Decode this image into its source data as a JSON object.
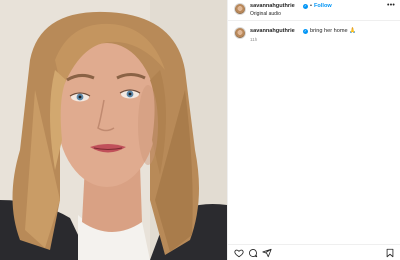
{
  "post": {
    "username": "savannahguthrie",
    "verified_glyph": "✓",
    "separator": "•",
    "follow_label": "Follow",
    "audio_label": "Original audio",
    "more_glyph": "•••"
  },
  "caption": {
    "username": "savannahguthrie",
    "verified_glyph": "✓",
    "text": "bring her home 🙏",
    "time": "11h"
  },
  "icons": {
    "like": "heart-icon",
    "comment": "comment-icon",
    "share": "share-icon",
    "save": "bookmark-icon",
    "more": "more-options-icon"
  },
  "colors": {
    "link_blue": "#0095f6",
    "text": "#262626",
    "muted": "#8e8e8e"
  }
}
